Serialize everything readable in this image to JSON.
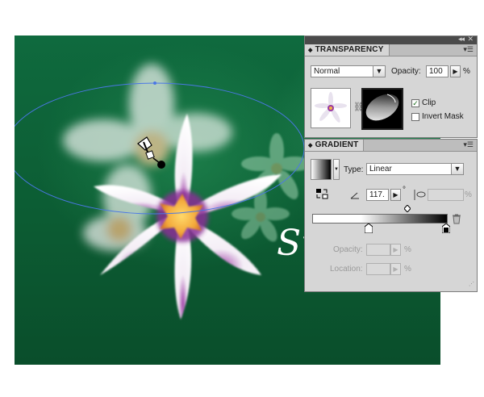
{
  "artwork": {
    "script_text": "Su"
  },
  "transparency_panel": {
    "title": "TRANSPARENCY",
    "blend_mode": "Normal",
    "opacity_label": "Opacity:",
    "opacity_value": "100",
    "opacity_unit": "%",
    "clip_label": "Clip",
    "clip_checked": true,
    "invert_mask_label": "Invert Mask",
    "invert_mask_checked": false
  },
  "gradient_panel": {
    "title": "GRADIENT",
    "type_label": "Type:",
    "type_value": "Linear",
    "angle_value": "117.",
    "angle_unit": "°",
    "aspect_unit": "%",
    "opacity_label": "Opacity:",
    "opacity_unit": "%",
    "location_label": "Location:",
    "location_unit": "%"
  },
  "icons": {
    "collapse": "double-arrow-icon",
    "close": "close-icon",
    "panel_menu": "panel-menu-icon",
    "reverse": "reverse-gradient-icon",
    "angle": "angle-icon",
    "aspect": "aspect-ratio-icon",
    "delete_stop": "trash-icon",
    "mask_link": "link-icon",
    "cursor": "gradient-tool-cursor-icon"
  }
}
